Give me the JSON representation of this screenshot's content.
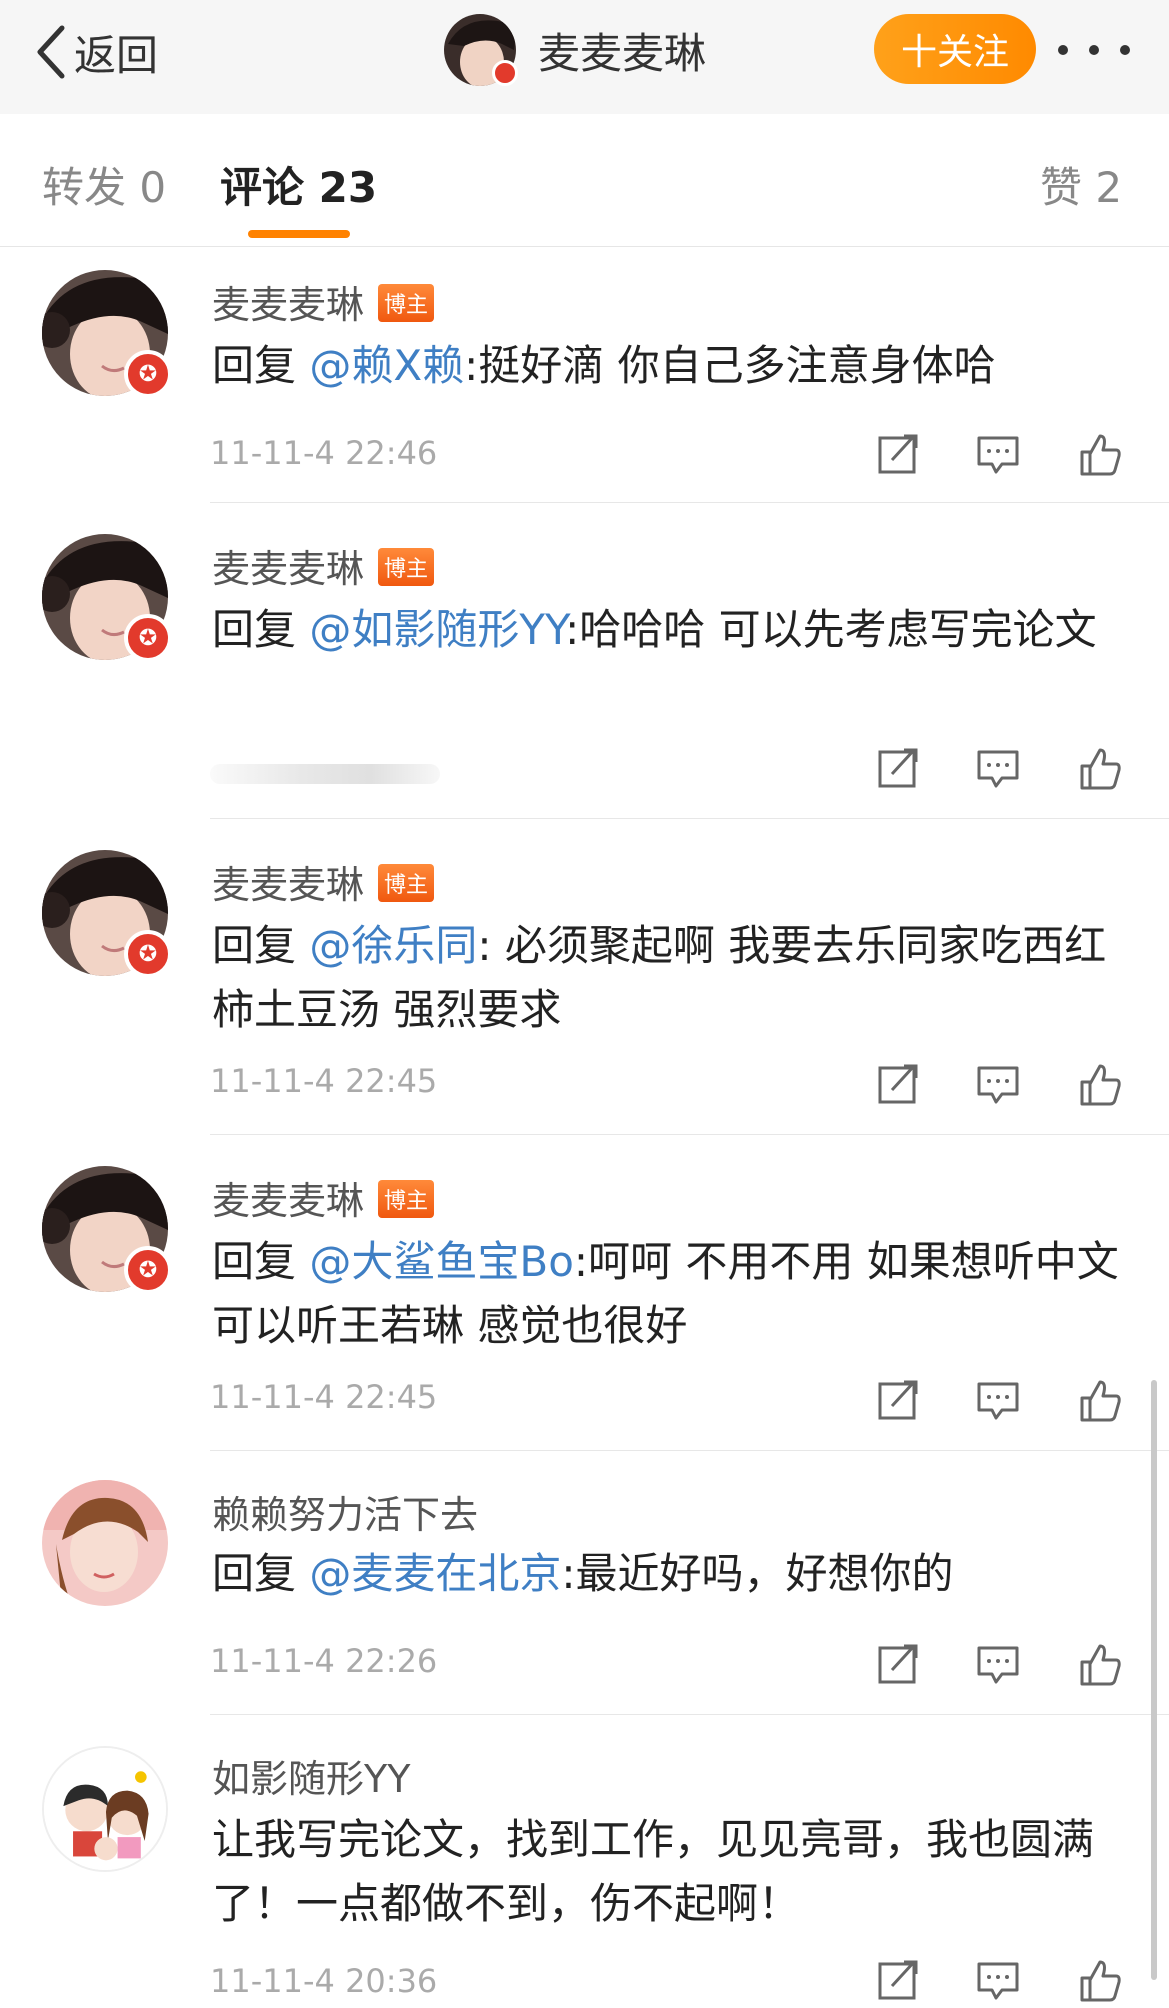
{
  "nav": {
    "back_label": "返回",
    "title": "麦麦麦琳",
    "follow_label": "十关注"
  },
  "tabs": {
    "repost": "转发 0",
    "comments": "评论 23",
    "likes": "赞 2"
  },
  "host_badge": "博主",
  "comments": [
    {
      "user": "麦麦麦琳",
      "is_host": true,
      "prefix": "回复",
      "mention": "@赖X赖",
      "text": ":挺好滴 你自己多注意身体哈",
      "time": "11-11-4 22:46"
    },
    {
      "user": "麦麦麦琳",
      "is_host": true,
      "prefix": "回复",
      "mention": "@如影随形YY",
      "text": ":哈哈哈 可以先考虑写完论文",
      "time": ""
    },
    {
      "user": "麦麦麦琳",
      "is_host": true,
      "prefix": "回复",
      "mention": "@徐乐同",
      "text": ": 必须聚起啊 我要去乐同家吃西红柿土豆汤 强烈要求",
      "time": "11-11-4 22:45"
    },
    {
      "user": "麦麦麦琳",
      "is_host": true,
      "prefix": "回复",
      "mention": "@大鲨鱼宝Bo",
      "text": ":呵呵 不用不用 如果想听中文可以听王若琳 感觉也很好",
      "time": "11-11-4 22:45"
    },
    {
      "user": "赖赖努力活下去",
      "is_host": false,
      "prefix": "回复",
      "mention": "@麦麦在北京",
      "text": ":最近好吗，好想你的",
      "time": "11-11-4 22:26"
    },
    {
      "user": "如影随形YY",
      "is_host": false,
      "prefix": "",
      "mention": "",
      "text": "让我写完论文，找到工作，见见亮哥，我也圆满了！一点都做不到，伤不起啊！",
      "time": "11-11-4 20:36"
    }
  ],
  "colors": {
    "accent": "#ff8200",
    "mention": "#3f7fc4",
    "verified": "#e23a2c"
  },
  "icons": [
    "chevron-left-icon",
    "more-icon",
    "repost-icon",
    "comment-icon",
    "like-icon",
    "verified-icon"
  ]
}
